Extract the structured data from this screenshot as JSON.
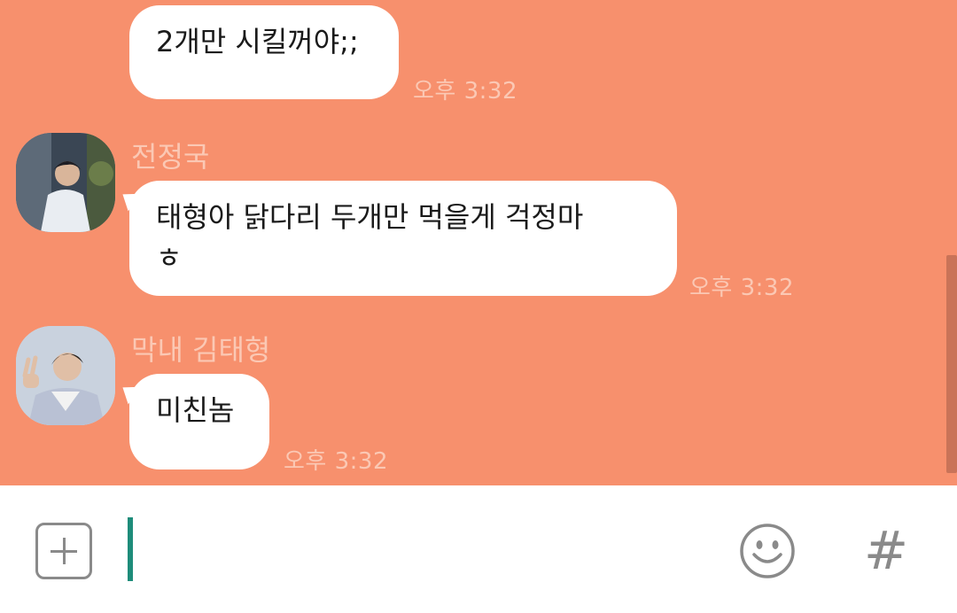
{
  "colors": {
    "chat_background": "#f7906d",
    "bubble": "#ffffff",
    "timestamp": "#fbc8b4",
    "sender_name": "#fbc8b4",
    "cursor": "#1e8c7a",
    "icon_gray": "#8a8a8a"
  },
  "messages": [
    {
      "text": "2개만 시킬꺼야;;",
      "time": "오후 3:32"
    },
    {
      "sender": "전정국",
      "avatar": "avatar-jungkook",
      "text": "태형아 닭다리 두개만 먹을게 걱정마\nㅎ",
      "time": "오후 3:32"
    },
    {
      "sender": "막내 김태형",
      "avatar": "avatar-taehyung",
      "text": "미친놈",
      "time": "오후 3:32"
    }
  ],
  "input_bar": {
    "value": "",
    "plus_icon": "plus-square-icon",
    "emoji_icon": "smiley-icon",
    "hash_label": "#"
  }
}
